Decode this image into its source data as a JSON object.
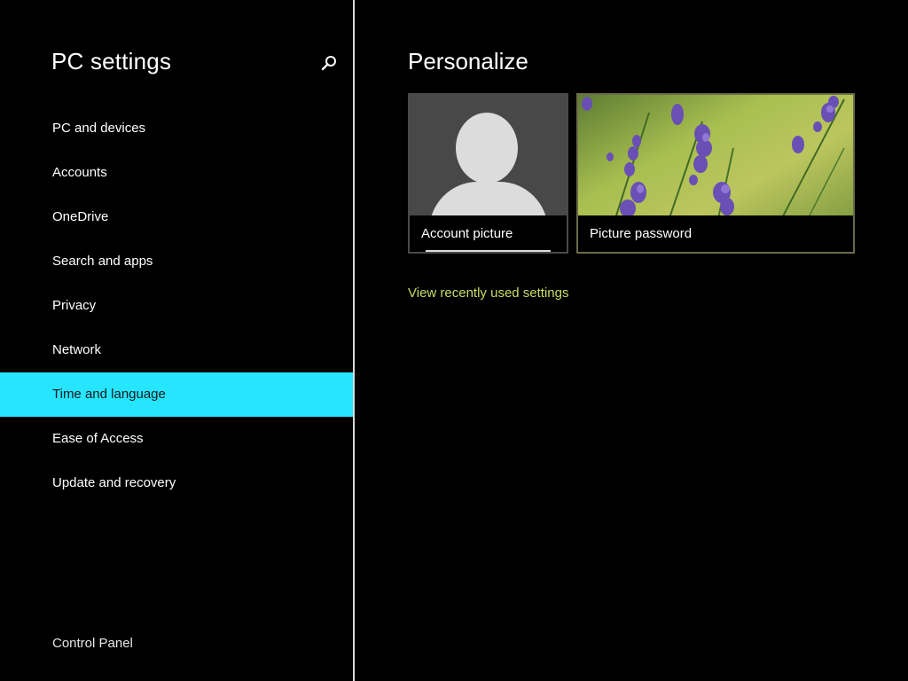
{
  "nav": {
    "title": "PC settings",
    "search_icon": "search-icon",
    "items": [
      {
        "label": "PC and devices",
        "selected": false
      },
      {
        "label": "Accounts",
        "selected": false
      },
      {
        "label": "OneDrive",
        "selected": false
      },
      {
        "label": "Search and apps",
        "selected": false
      },
      {
        "label": "Privacy",
        "selected": false
      },
      {
        "label": "Network",
        "selected": false
      },
      {
        "label": "Time and language",
        "selected": true
      },
      {
        "label": "Ease of Access",
        "selected": false
      },
      {
        "label": "Update and recovery",
        "selected": false
      }
    ],
    "footer_link": "Control Panel"
  },
  "content": {
    "title": "Personalize",
    "tiles": [
      {
        "label": "Account picture",
        "image": "default-user-avatar"
      },
      {
        "label": "Picture password",
        "image": "lavender-flowers-photo"
      }
    ],
    "recent_link": "View recently used settings"
  },
  "colors": {
    "accent": "#26e5ff",
    "background": "#000000",
    "link": "#c8dc64",
    "divider": "#d9d9d9"
  }
}
